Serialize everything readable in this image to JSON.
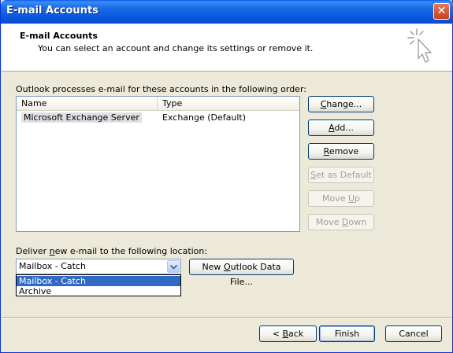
{
  "window": {
    "title": "E-mail Accounts",
    "close_glyph": "✕"
  },
  "header": {
    "title": "E-mail Accounts",
    "subtitle": "You can select an account and change its settings or remove it."
  },
  "accounts": {
    "label": "Outlook processes e-mail for these accounts in the following order:",
    "columns": [
      "Name",
      "Type"
    ],
    "rows": [
      {
        "name": "Microsoft Exchange Server",
        "type": "Exchange (Default)"
      }
    ]
  },
  "side_buttons": {
    "change": {
      "pre": "",
      "key": "C",
      "post": "hange..."
    },
    "add": {
      "pre": "",
      "key": "A",
      "post": "dd..."
    },
    "remove": {
      "pre": "",
      "key": "R",
      "post": "emove"
    },
    "set_default": {
      "pre": "",
      "key": "S",
      "post": "et as Default"
    },
    "move_up": {
      "pre": "Move ",
      "key": "U",
      "post": "p"
    },
    "move_down": {
      "pre": "Move ",
      "key": "D",
      "post": "own"
    }
  },
  "deliver": {
    "label_pre": "Deliver ",
    "label_key": "n",
    "label_post": "ew e-mail to the following location:",
    "selected": "Mailbox - Catch",
    "options": [
      "Mailbox - Catch",
      "Archive"
    ],
    "new_file": {
      "pre": "New ",
      "key": "O",
      "post": "utlook Data File..."
    }
  },
  "footer": {
    "back": {
      "pre": "< ",
      "key": "B",
      "post": "ack"
    },
    "finish": "Finish",
    "cancel": "Cancel"
  },
  "colors": {
    "title_bar": "#0a5ef0",
    "selection": "#316ac5",
    "face": "#ece9d8"
  }
}
